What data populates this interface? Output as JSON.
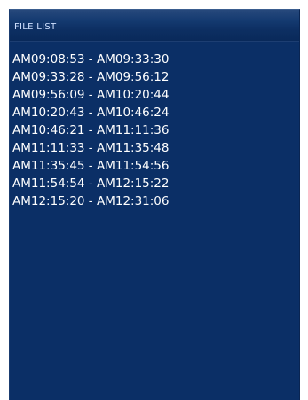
{
  "panel": {
    "title": "FILE LIST"
  },
  "files": [
    {
      "label": "AM09:08:53 - AM09:33:30"
    },
    {
      "label": "AM09:33:28 - AM09:56:12"
    },
    {
      "label": "AM09:56:09 - AM10:20:44"
    },
    {
      "label": "AM10:20:43 - AM10:46:24"
    },
    {
      "label": "AM10:46:21 - AM11:11:36"
    },
    {
      "label": "AM11:11:33 - AM11:35:48"
    },
    {
      "label": "AM11:35:45 - AM11:54:56"
    },
    {
      "label": "AM11:54:54 - AM12:15:22"
    },
    {
      "label": "AM12:15:20 - AM12:31:06"
    }
  ],
  "colors": {
    "panel_background": "#0b2f66",
    "header_text": "#cfe0ff",
    "item_text": "#ffffff"
  }
}
